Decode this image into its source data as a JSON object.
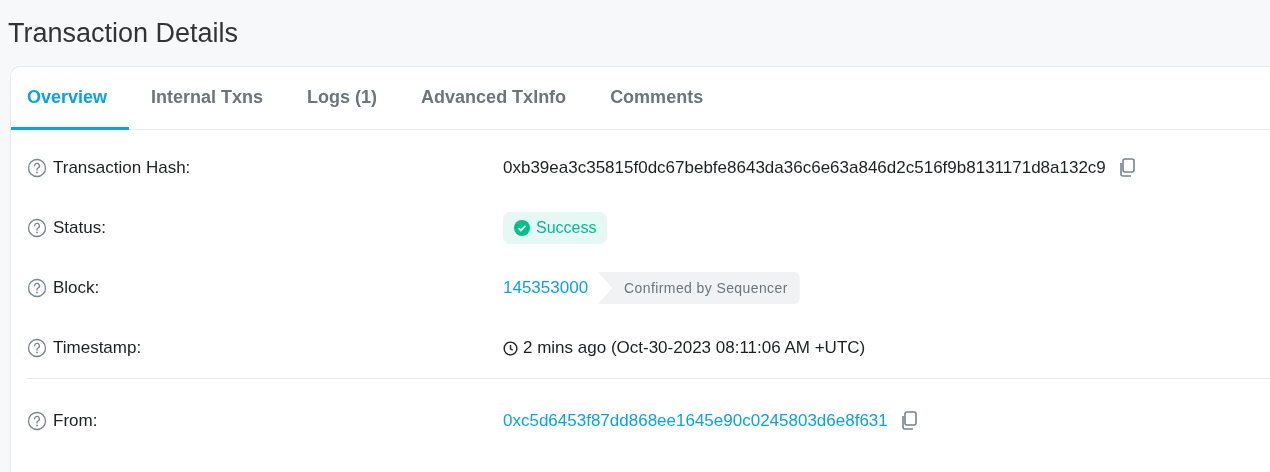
{
  "title": "Transaction Details",
  "tabs": [
    {
      "label": "Overview",
      "selected": true
    },
    {
      "label": "Internal Txns",
      "selected": false
    },
    {
      "label": "Logs (1)",
      "selected": false
    },
    {
      "label": "Advanced TxInfo",
      "selected": false
    },
    {
      "label": "Comments",
      "selected": false
    }
  ],
  "groups": [
    [
      {
        "kind": "hash",
        "label": "Transaction Hash:",
        "value": "0xb39ea3c35815f0dc67bebfe8643da36c6e63a846d2c516f9b8131171d8a132c9"
      },
      {
        "kind": "status",
        "label": "Status:",
        "value": "Success"
      },
      {
        "kind": "block",
        "label": "Block:",
        "value": "145353000",
        "note": "Confirmed by Sequencer"
      },
      {
        "kind": "time",
        "label": "Timestamp:",
        "value": "2 mins ago (Oct-30-2023 08:11:06 AM +UTC)"
      }
    ],
    [
      {
        "kind": "address",
        "label": "From:",
        "value": "0xc5d6453f87dd868ee1645e90c0245803d6e8f631"
      }
    ]
  ]
}
